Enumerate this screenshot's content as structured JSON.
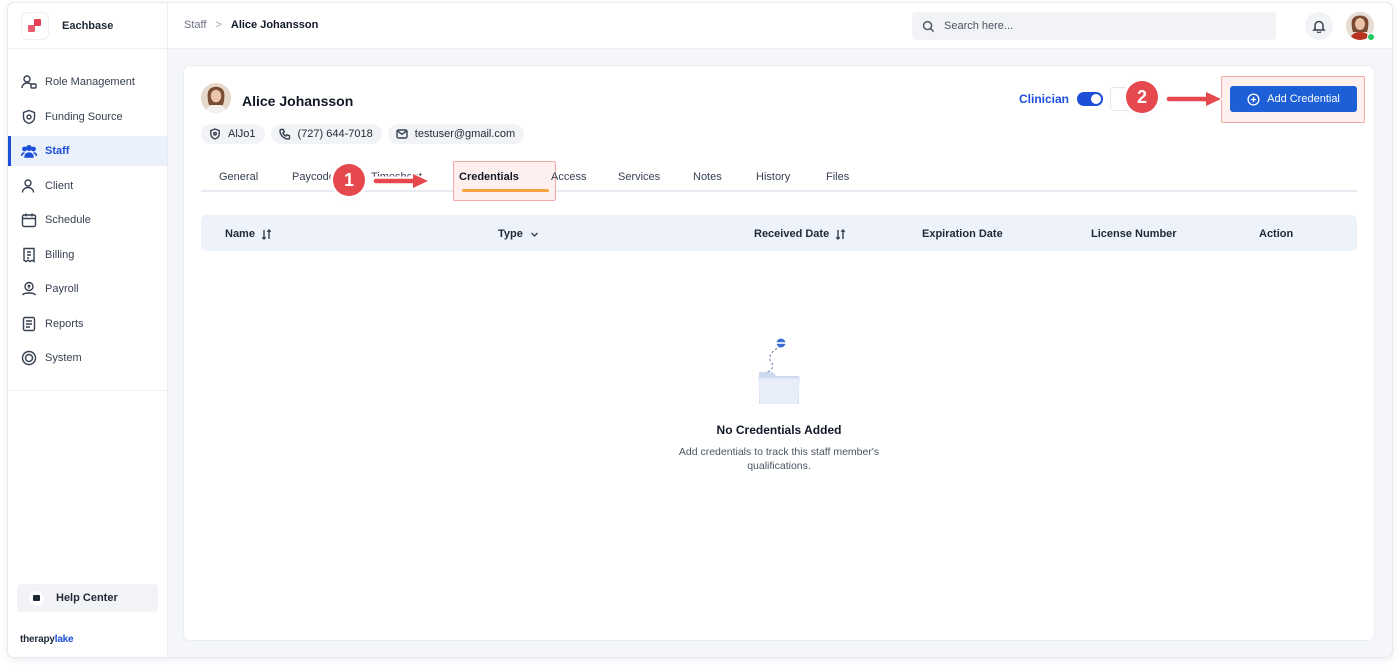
{
  "app": {
    "brand": "Eachbase",
    "powered_prefix": "therapy",
    "powered_suffix": "lake"
  },
  "sidebar": {
    "items": [
      {
        "label": "Role Management",
        "icon": "role-management-icon"
      },
      {
        "label": "Funding Source",
        "icon": "shield-icon"
      },
      {
        "label": "Staff",
        "icon": "staff-icon",
        "active": true
      },
      {
        "label": "Client",
        "icon": "client-icon"
      },
      {
        "label": "Schedule",
        "icon": "calendar-icon"
      },
      {
        "label": "Billing",
        "icon": "billing-icon"
      },
      {
        "label": "Payroll",
        "icon": "payroll-icon"
      },
      {
        "label": "Reports",
        "icon": "reports-icon"
      },
      {
        "label": "System",
        "icon": "system-icon"
      }
    ],
    "help": "Help Center"
  },
  "topbar": {
    "breadcrumb": {
      "parent": "Staff",
      "separator": ">",
      "current": "Alice Johansson"
    },
    "search_placeholder": "Search here..."
  },
  "profile": {
    "name": "Alice Johansson",
    "id_chip": "AlJo1",
    "phone": "(727) 644-7018",
    "email": "testuser@gmail.com",
    "clinician_label": "Clinician",
    "clinician_on": true
  },
  "actions": {
    "add_credential": "Add Credential"
  },
  "tabs": [
    "General",
    "Paycodes",
    "Timesheet",
    "Credentials",
    "Access",
    "Services",
    "Notes",
    "History",
    "Files"
  ],
  "active_tab": "Credentials",
  "table": {
    "columns": [
      "Name",
      "Type",
      "Received Date",
      "Expiration Date",
      "License Number",
      "Action"
    ],
    "rows": []
  },
  "empty_state": {
    "title": "No Credentials Added",
    "description": "Add credentials to track this staff member's qualifications."
  },
  "callouts": [
    "1",
    "2"
  ],
  "colors": {
    "accent": "#1d5fd6",
    "callout": "#e5484d",
    "tab_underline": "#f4a541",
    "highlight": "#fdf0ee"
  }
}
